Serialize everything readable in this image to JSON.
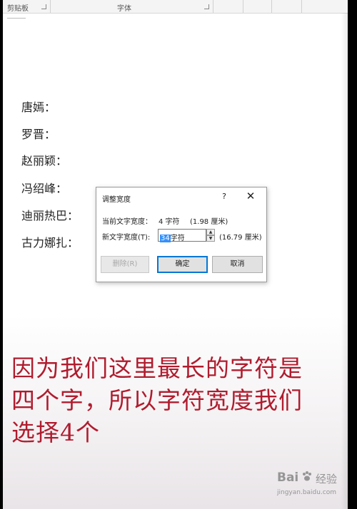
{
  "ribbon": {
    "clipboard_label": "剪贴板",
    "font_label": "字体"
  },
  "document": {
    "names": [
      "唐嫣：",
      "罗晋：",
      "赵丽颖：",
      "冯绍峰：",
      "迪丽热巴：",
      "古力娜扎："
    ]
  },
  "dialog": {
    "title": "调整宽度",
    "help": "?",
    "close": "✕",
    "current_label": "当前文字宽度：",
    "current_value": "4 字符",
    "current_cm": "(1.98 厘米)",
    "new_label": "新文字宽度(T):",
    "new_value_selected": "34",
    "new_value_unit": "字符",
    "new_cm": "(16.79 厘米)",
    "delete_label": "删除(R)",
    "ok_label": "确定",
    "cancel_label": "取消"
  },
  "overlay": {
    "line1": "因为我们这里最长的字符是",
    "line2": "四个字，所以字符宽度我们",
    "line3": "选择4个"
  },
  "watermark": {
    "brand": "Bai",
    "brand2": "经验",
    "url": "jingyan.baidu.com"
  }
}
